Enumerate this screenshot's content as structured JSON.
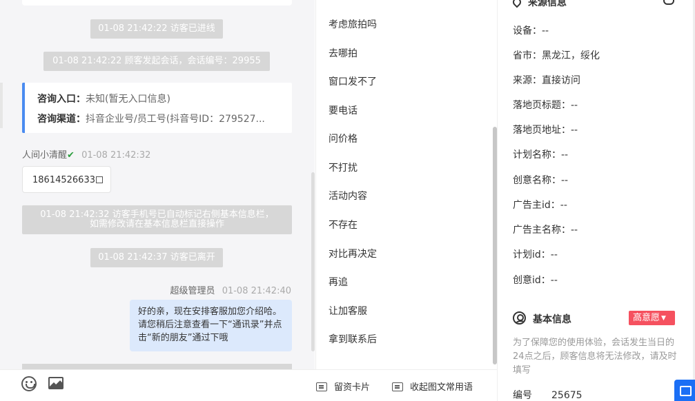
{
  "chat": {
    "sys1": "01-08 21:42:22 访客已进线",
    "sys2": "01-08 21:42:22 顾客发起会话，会话编号：29955",
    "entry_label": "咨询入口：",
    "entry_value": "未知(暂无入口信息)",
    "channel_label": "咨询渠道：",
    "channel_value": "抖音企业号/员工号(抖音号ID：279527...",
    "visitor_name": "人间小清醒",
    "visitor_time": "01-08 21:42:32",
    "visitor_phone": "18614526633",
    "sys3_line1": "01-08 21:42:32 访客手机号已自动标记右侧基本信息栏，",
    "sys3_line2": "如需修改请在基本信息栏直接操作",
    "sys4": "01-08 21:42:37 访客已离开",
    "agent_name": "超级管理员",
    "agent_time": "01-08 21:42:40",
    "agent_msg": "好的亲，现在安排客服加您介绍哈。请您稍后注意查看一下“通讯录”并点击“新的朋友”通过下哦"
  },
  "toolbar": {
    "card_label": "留资卡片",
    "collapse_label": "收起图文常用语"
  },
  "phrases": [
    "考虑旅拍吗",
    "去哪拍",
    "窗口发不了",
    "要电话",
    "问价格",
    "不打扰",
    "活动内容",
    "不存在",
    "对比再决定",
    "再追",
    "让加客服",
    "拿到联系后"
  ],
  "source": {
    "title": "来源信息",
    "rows": [
      "设备：--",
      "省市：黑龙江，绥化",
      "来源：直接访问",
      "落地页标题：--",
      "落地页地址：--",
      "计划名称：--",
      "创意名称：--",
      "广告主id：--",
      "广告主名称：--",
      "计划id：--",
      "创意id：--"
    ]
  },
  "basic": {
    "title": "基本信息",
    "badge": "高意愿",
    "hint": "为了保障您的使用体验，会话发生当日的24点之后，顾客信息将无法修改，请及时填写",
    "id_label": "编号",
    "id_value": "25675"
  },
  "colors": {
    "accent": "#4a8bf0",
    "bubble": "#dce9fc",
    "badge": "#f5515f",
    "float": "#1b6ff5"
  }
}
